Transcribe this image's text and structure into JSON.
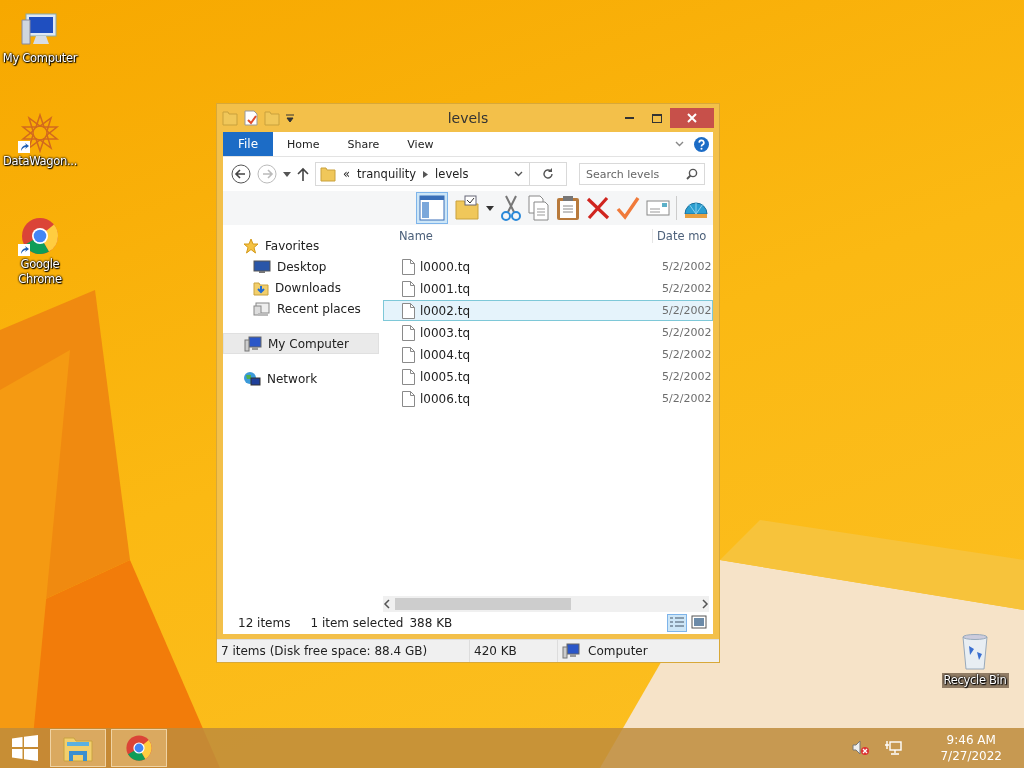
{
  "desktop_icons": [
    {
      "label": "My Computer",
      "kind": "computer"
    },
    {
      "label": "DataWagon...",
      "kind": "star"
    },
    {
      "label": "Google Chrome",
      "kind": "chrome"
    },
    {
      "label": "Recycle Bin",
      "kind": "bin"
    }
  ],
  "window": {
    "title": "levels",
    "ribbon_tabs": [
      {
        "label": "File",
        "kind": "file-menu"
      },
      {
        "label": "Home",
        "kind": "tab"
      },
      {
        "label": "Share",
        "kind": "tab"
      },
      {
        "label": "View",
        "kind": "tab"
      }
    ],
    "address": {
      "overflow": "«",
      "crumbs": [
        "tranquility",
        "levels"
      ]
    },
    "search": {
      "placeholder": "Search levels"
    },
    "nav_pane": [
      {
        "label": "Favorites",
        "kind": "star",
        "selected": false,
        "children": [
          {
            "label": "Desktop",
            "kind": "desktop",
            "selected": false
          },
          {
            "label": "Downloads",
            "kind": "downloads",
            "selected": false
          },
          {
            "label": "Recent places",
            "kind": "recent",
            "selected": false
          }
        ]
      },
      {
        "label": "My Computer",
        "kind": "computer",
        "selected": true
      },
      {
        "label": "Network",
        "kind": "network",
        "selected": false
      }
    ],
    "columns": [
      "Name",
      "Date mo"
    ],
    "files": [
      {
        "name": "l0000.tq",
        "date": "5/2/2002",
        "selected": false
      },
      {
        "name": "l0001.tq",
        "date": "5/2/2002",
        "selected": false
      },
      {
        "name": "l0002.tq",
        "date": "5/2/2002",
        "selected": true
      },
      {
        "name": "l0003.tq",
        "date": "5/2/2002",
        "selected": false
      },
      {
        "name": "l0004.tq",
        "date": "5/2/2002",
        "selected": false
      },
      {
        "name": "l0005.tq",
        "date": "5/2/2002",
        "selected": false
      },
      {
        "name": "l0006.tq",
        "date": "5/2/2002",
        "selected": false
      }
    ],
    "item_count": "12 items",
    "selection_info": "1 item selected",
    "selection_size": "388 KB",
    "status_bar": [
      "7 items (Disk free space: 88.4 GB)",
      "420 KB",
      "Computer"
    ]
  },
  "taskbar": {
    "apps": [
      {
        "kind": "explorer",
        "active": true
      },
      {
        "kind": "chrome",
        "active": true
      }
    ],
    "clock": {
      "time": "9:46 AM",
      "date": "7/27/2022"
    }
  }
}
